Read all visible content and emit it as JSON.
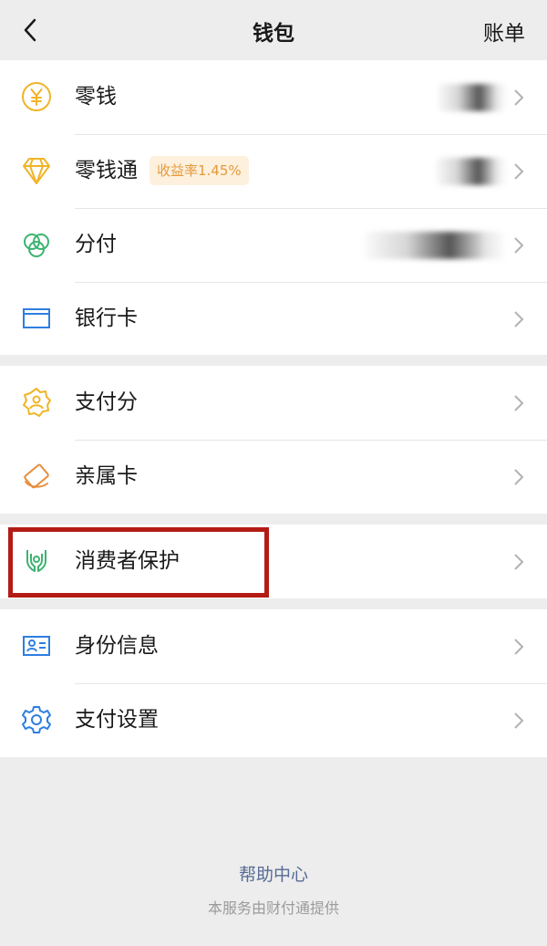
{
  "nav": {
    "title": "钱包",
    "right_label": "账单"
  },
  "groups": [
    {
      "items": [
        {
          "label": "零钱"
        },
        {
          "label": "零钱通",
          "badge": "收益率1.45%"
        },
        {
          "label": "分付"
        },
        {
          "label": "银行卡"
        }
      ]
    },
    {
      "items": [
        {
          "label": "支付分"
        },
        {
          "label": "亲属卡"
        }
      ]
    },
    {
      "items": [
        {
          "label": "消费者保护"
        }
      ]
    },
    {
      "items": [
        {
          "label": "身份信息"
        },
        {
          "label": "支付设置"
        }
      ]
    }
  ],
  "footer": {
    "help": "帮助中心",
    "provider": "本服务由财付通提供"
  },
  "colors": {
    "yellow": "#f0b428",
    "green": "#3cb371",
    "blue": "#2d7fe0",
    "orange": "#e88d3c",
    "highlight": "#b31b14"
  }
}
